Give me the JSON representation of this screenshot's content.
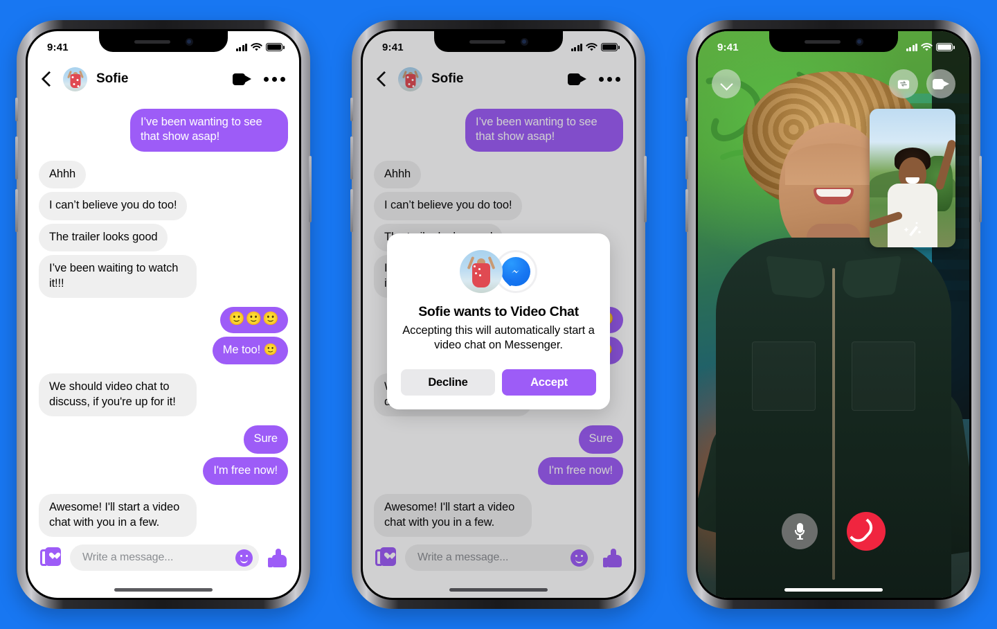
{
  "colors": {
    "background_blue": "#1877F2",
    "bubble_purple": "#9D5CF7",
    "bubble_gray": "#EFEFEF",
    "end_call_red": "#F0253F",
    "messenger_blue": "#1877F2"
  },
  "status_bar": {
    "time": "9:41",
    "cellular": "signal-bars",
    "wifi": "wifi-icon",
    "battery": "battery-full-icon"
  },
  "phone1": {
    "label": "messenger-chat-screen",
    "header": {
      "back": "back-chevron",
      "avatar_alt": "Sofie",
      "name": "Sofie",
      "video_call": "video-camera-icon",
      "more": "more-options-icon"
    },
    "messages": [
      {
        "side": "out",
        "text": "I’ve been wanting to see that show asap!",
        "emoji_only": false
      },
      {
        "side": "in",
        "text": "Ahhh",
        "emoji_only": false
      },
      {
        "side": "in",
        "text": "I can’t believe you do too!",
        "emoji_only": false
      },
      {
        "side": "in",
        "text": "The trailer looks good",
        "emoji_only": false
      },
      {
        "side": "in",
        "text": "I’ve been waiting to watch it!!!",
        "emoji_only": false
      },
      {
        "side": "out",
        "text": "🙂🙂🙂",
        "emoji_only": true
      },
      {
        "side": "out",
        "text": "Me too! 🙂",
        "emoji_only": false
      },
      {
        "side": "in",
        "text": "We should video chat to discuss, if you're up for it!",
        "emoji_only": false
      },
      {
        "side": "out",
        "text": "Sure",
        "emoji_only": false
      },
      {
        "side": "out",
        "text": "I'm free now!",
        "emoji_only": false
      },
      {
        "side": "in",
        "text": "Awesome! I'll start a video chat with you in a few.",
        "emoji_only": false
      }
    ],
    "composer": {
      "stickers": "stickers-icon",
      "placeholder": "Write a message...",
      "emoji": "emoji-smiley-icon",
      "like": "thumbs-up-icon"
    }
  },
  "phone2": {
    "label": "messenger-chat-with-video-chat-request-modal",
    "header": {
      "back": "back-chevron",
      "avatar_alt": "Sofie",
      "name": "Sofie",
      "video_call": "video-camera-icon",
      "more": "more-options-icon"
    },
    "modal": {
      "avatar_alt": "Sofie",
      "app_icon": "messenger-logo-icon",
      "title": "Sofie wants to Video Chat",
      "body": "Accepting this will automatically start a video chat on Messenger.",
      "decline_label": "Decline",
      "accept_label": "Accept"
    },
    "composer": {
      "stickers": "stickers-icon",
      "placeholder": "Write a message...",
      "emoji": "emoji-smiley-icon",
      "like": "thumbs-up-icon"
    }
  },
  "phone3": {
    "label": "messenger-active-video-call-screen",
    "top_controls": {
      "minimize": "chevron-down-icon",
      "flip_camera": "camera-flip-icon",
      "toggle_video": "video-camera-icon"
    },
    "self_view": "picture-in-picture-self-view",
    "bottom_controls": {
      "mute": "microphone-icon",
      "end_call": "end-call-handset-icon"
    }
  }
}
